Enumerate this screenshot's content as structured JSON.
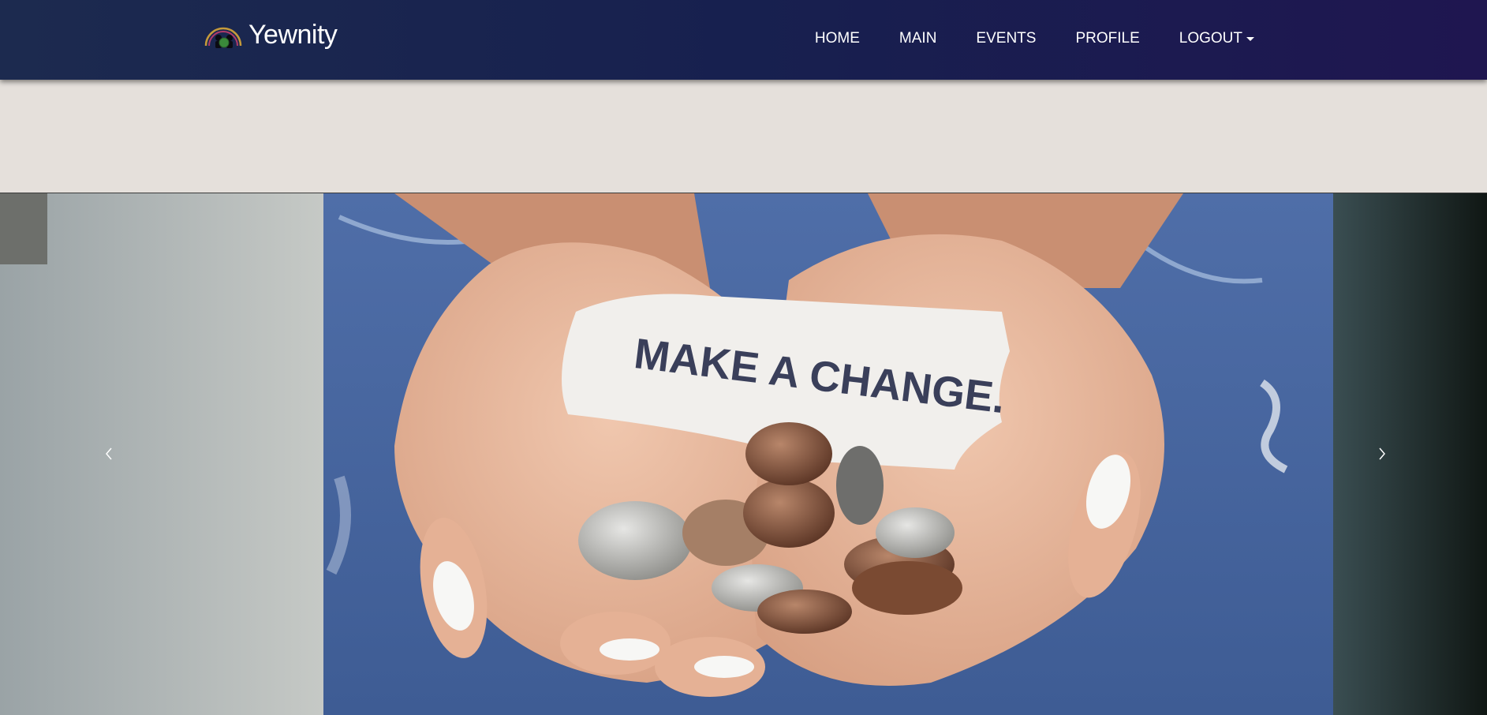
{
  "brand": {
    "name": "Yewnity",
    "logo_icon": "yewnity-logo-icon"
  },
  "nav": {
    "items": [
      {
        "label": "HOME"
      },
      {
        "label": "MAIN"
      },
      {
        "label": "EVENTS"
      },
      {
        "label": "PROFILE"
      },
      {
        "label": "LOGOUT",
        "has_dropdown": true
      }
    ]
  },
  "carousel": {
    "slide_text": "MAKE A CHANGE.",
    "prev_icon": "chevron-left-icon",
    "next_icon": "chevron-right-icon"
  },
  "colors": {
    "navbar_start": "#1c2a4f",
    "navbar_end": "#1f1650",
    "page_background": "#e5e0db"
  }
}
